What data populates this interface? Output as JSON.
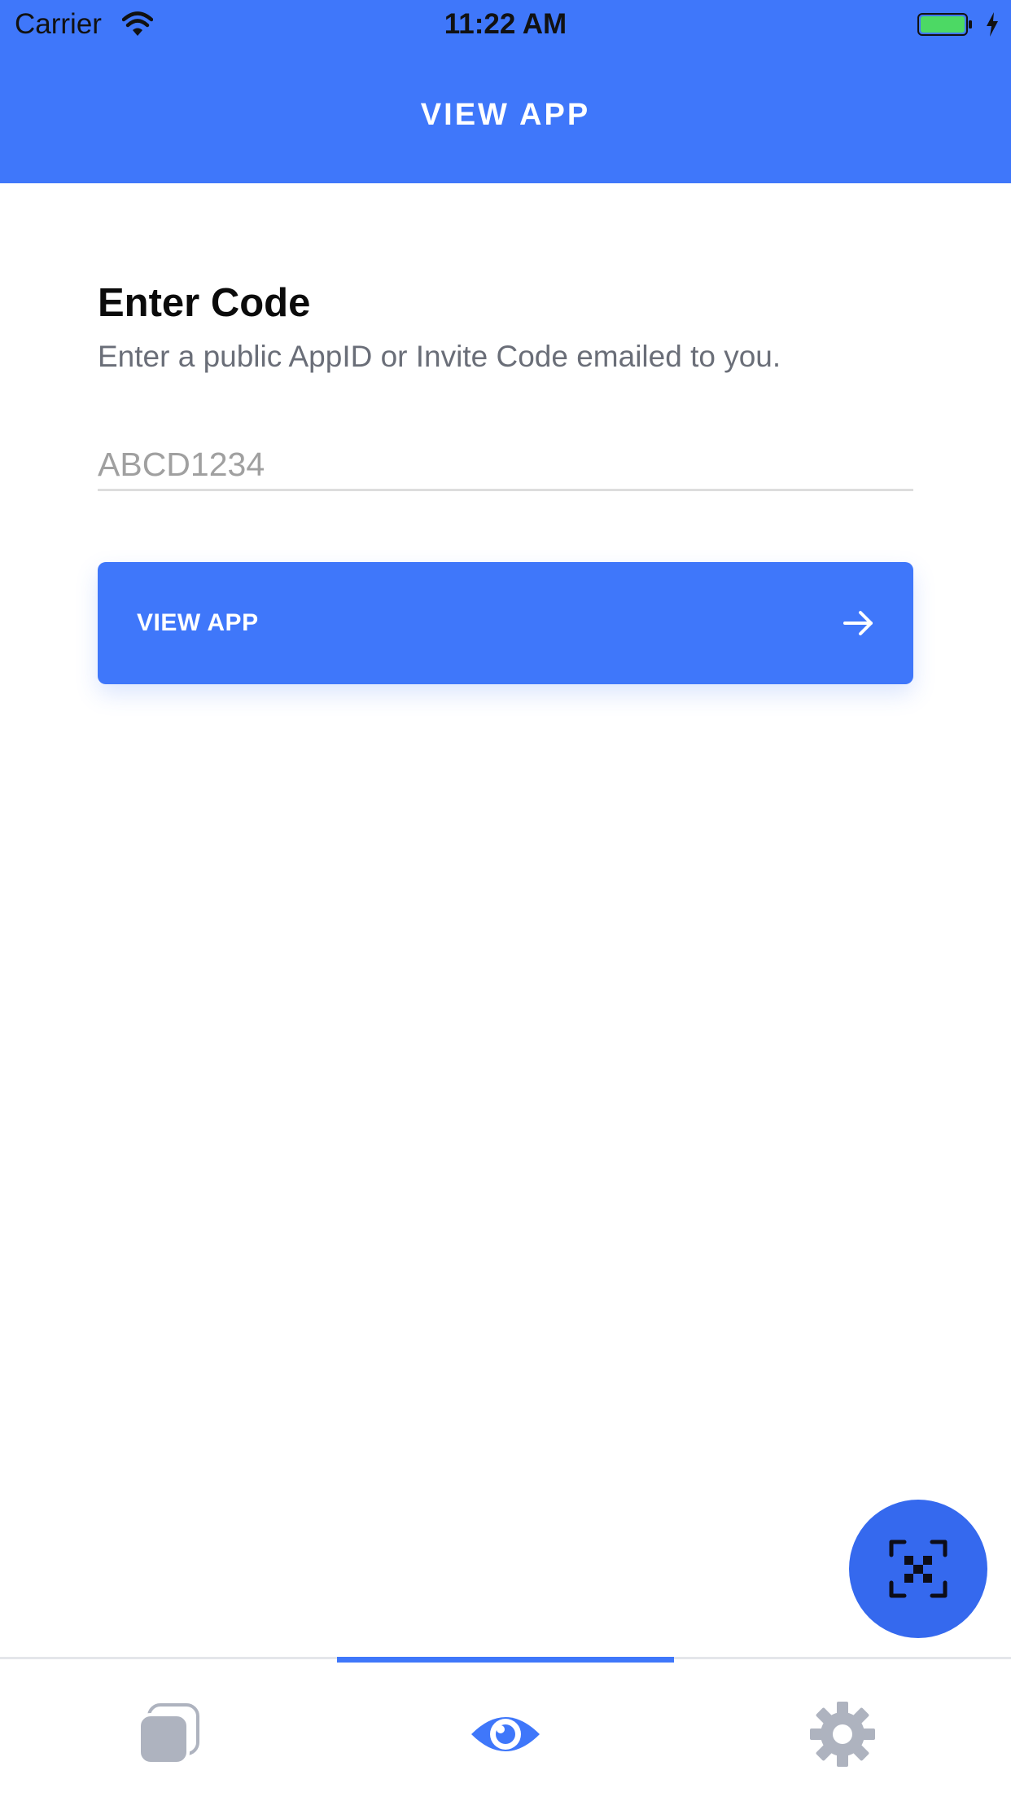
{
  "status_bar": {
    "carrier": "Carrier",
    "time": "11:22 AM",
    "wifi_icon": "wifi-icon",
    "battery_icon": "battery-charging-icon"
  },
  "nav": {
    "title": "VIEW APP"
  },
  "main": {
    "title": "Enter Code",
    "subtitle": "Enter a public AppID or Invite Code emailed to you.",
    "code_input": {
      "value": "",
      "placeholder": "ABCD1234"
    },
    "view_button": {
      "label": "VIEW APP",
      "icon": "arrow-right-icon"
    }
  },
  "fab": {
    "icon": "qr-scan-icon"
  },
  "tabs": [
    {
      "name": "apps",
      "icon": "stacked-cards-icon",
      "active": false
    },
    {
      "name": "view",
      "icon": "eye-icon",
      "active": true
    },
    {
      "name": "settings",
      "icon": "gear-icon",
      "active": false
    }
  ],
  "colors": {
    "accent": "#3f77fa",
    "fab": "#3569ee",
    "inactive_icon": "#aeb3bf",
    "title_text": "#0b0b0b",
    "subtitle_text": "#6a6e78",
    "battery_fill": "#4cd964"
  }
}
